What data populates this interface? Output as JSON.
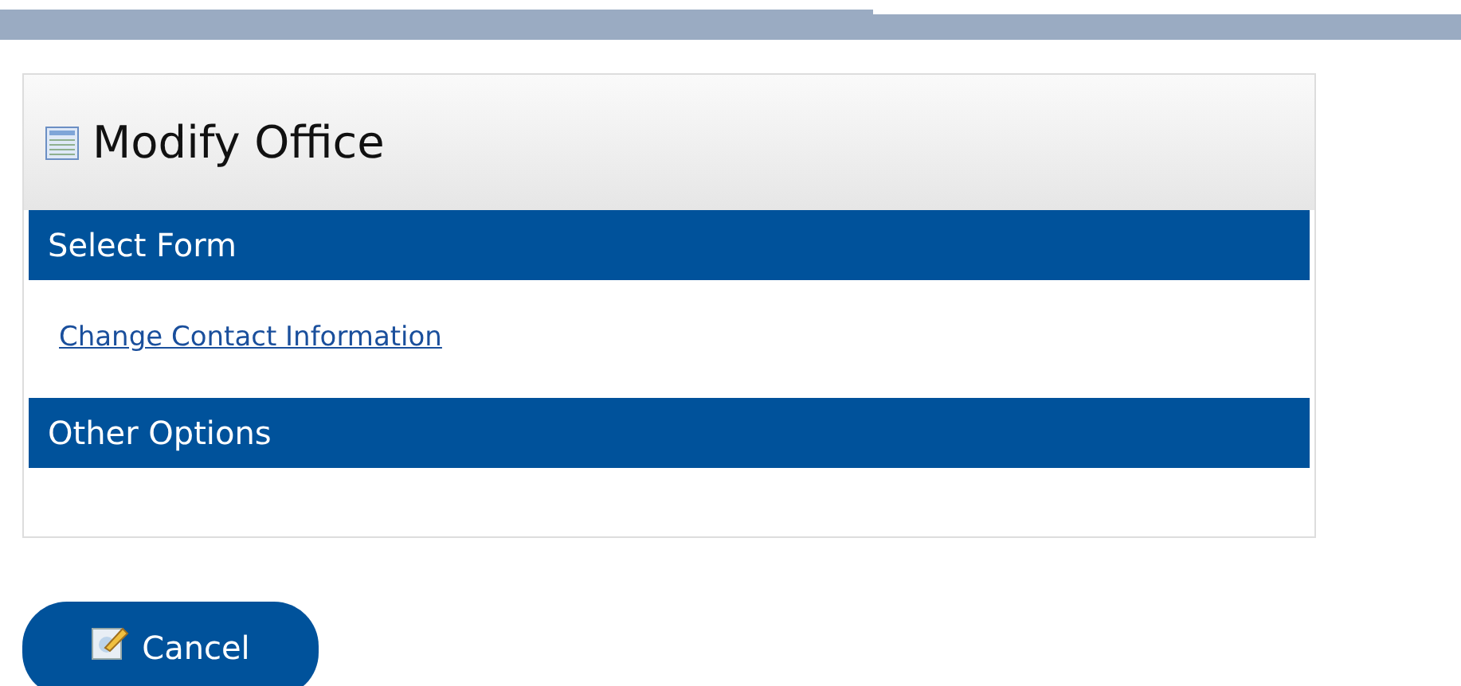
{
  "panel": {
    "title": "Modify Office",
    "sections": [
      {
        "heading": "Select Form",
        "links": [
          "Change Contact Information"
        ]
      },
      {
        "heading": "Other Options"
      }
    ]
  },
  "buttons": [
    {
      "label": "Cancel"
    }
  ]
}
